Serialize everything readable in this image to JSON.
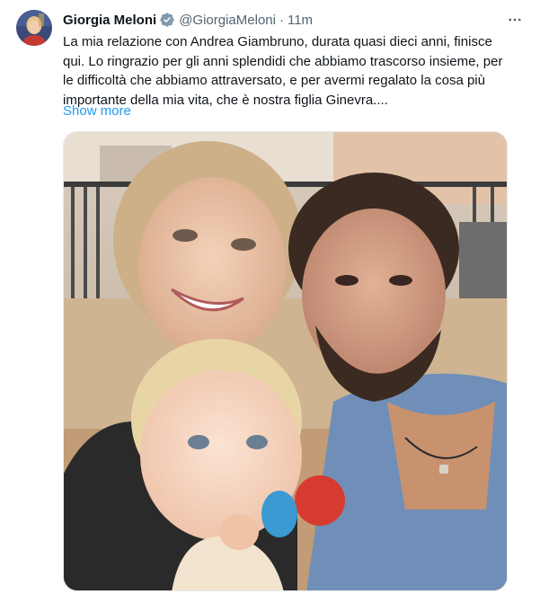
{
  "tweet": {
    "author_name": "Giorgia Meloni",
    "handle": "@GiorgiaMeloni",
    "separator": "·",
    "time": "11m",
    "text_lines": [
      "La mia relazione con Andrea Giambruno, durata quasi dieci anni, finisce",
      "qui. Lo ringrazio per gli anni splendidi che abbiamo trascorso insieme, per",
      "le difficoltà che abbiamo attraversato, e per avermi regalato la cosa più",
      "importante della mia vita, che è nostra figlia Ginevra...."
    ],
    "show_more": "Show more"
  },
  "icons": {
    "verified": "verified-badge-icon",
    "more": "more-options-icon"
  },
  "colors": {
    "accent": "#1d9bf0",
    "secondary_text": "#536471",
    "primary_text": "#0f1419"
  }
}
